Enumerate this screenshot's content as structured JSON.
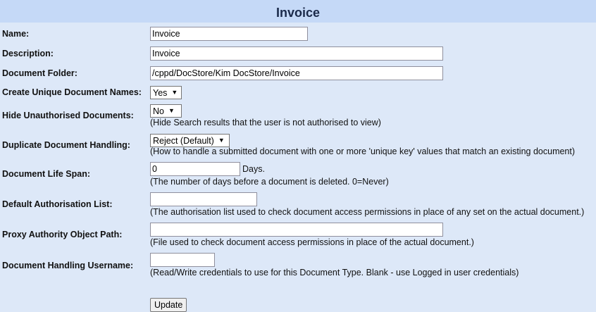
{
  "page": {
    "title": "Invoice"
  },
  "fields": {
    "name": {
      "label": "Name:",
      "value": "Invoice"
    },
    "description": {
      "label": "Description:",
      "value": "Invoice"
    },
    "folder": {
      "label": "Document Folder:",
      "value": "/cppd/DocStore/Kim DocStore/Invoice"
    },
    "unique_names": {
      "label": "Create Unique Document Names:",
      "selected": "Yes"
    },
    "hide_unauth": {
      "label": "Hide Unauthorised Documents:",
      "selected": "No",
      "hint": "(Hide Search results that the user is not authorised to view)"
    },
    "duplicate": {
      "label": "Duplicate Document Handling:",
      "selected": "Reject (Default)",
      "hint": "(How to handle a submitted document with one or more 'unique key' values that match an existing document)"
    },
    "life_span": {
      "label": "Document Life Span:",
      "value": "0",
      "suffix": "Days.",
      "hint": "(The number of days before a document is deleted. 0=Never)"
    },
    "auth_list": {
      "label": "Default Authorisation List:",
      "value": "",
      "hint": "(The authorisation list used to check document access permissions in place of any set on the actual document.)"
    },
    "proxy_path": {
      "label": "Proxy Authority Object Path:",
      "value": "",
      "hint": "(File used to check document access permissions in place of the actual document.)"
    },
    "handling_user": {
      "label": "Document Handling Username:",
      "value": "",
      "hint": "(Read/Write credentials to use for this Document Type. Blank - use Logged in user credentials)"
    }
  },
  "actions": {
    "update_label": "Update"
  },
  "colors": {
    "background": "#dde8f8",
    "titlebar": "#c5d9f7",
    "title_text": "#1b2a4a"
  }
}
